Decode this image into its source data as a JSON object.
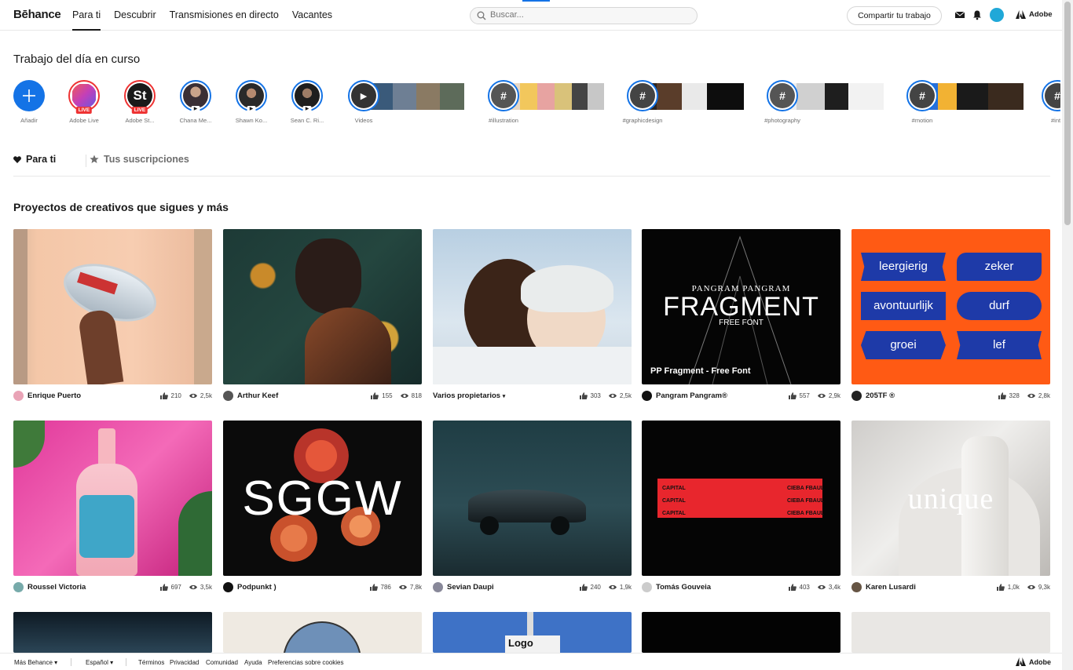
{
  "header": {
    "logo": "Bēhance",
    "nav": [
      "Para ti",
      "Descubrir",
      "Transmisiones en directo",
      "Vacantes"
    ],
    "search_placeholder": "Buscar...",
    "share_label": "Compartir tu trabajo",
    "adobe_label": "Adobe",
    "colors": {
      "accent": "#1473e6"
    }
  },
  "featured": {
    "title": "Trabajo del día en curso",
    "stories": [
      {
        "label": "Añadir"
      },
      {
        "label": "Adobe Live",
        "badge": "LIVE"
      },
      {
        "label": "Adobe St...",
        "badge": "LIVE",
        "glyph": "St"
      },
      {
        "label": "Chana Me..."
      },
      {
        "label": "Shawn Ko..."
      },
      {
        "label": "Sean C. Ri..."
      },
      {
        "label": "Videos"
      },
      {
        "label": "#illustration",
        "glyph": "#"
      },
      {
        "label": "#graphicdesign",
        "glyph": "#"
      },
      {
        "label": "#photography",
        "glyph": "#"
      },
      {
        "label": "#motion",
        "glyph": "#"
      },
      {
        "label": "#inte",
        "glyph": "#"
      }
    ]
  },
  "tabs": {
    "for_you": "Para ti",
    "subscriptions": "Tus suscripciones"
  },
  "projects": {
    "title": "Proyectos de creativos que sigues y más",
    "items": [
      {
        "owner": "Enrique Puerto",
        "likes": "210",
        "views": "2,5k"
      },
      {
        "owner": "Arthur Keef",
        "likes": "155",
        "views": "818"
      },
      {
        "owner": "Varios propietarios",
        "likes": "303",
        "views": "2,5k"
      },
      {
        "owner": "Pangram Pangram®",
        "likes": "557",
        "views": "2,9k",
        "caption": "PP Fragment - Free Font",
        "art_top": "PANGRAM PANGRAM",
        "art_main": "FRAGMENT",
        "art_sub": "FREE FONT"
      },
      {
        "owner": "205TF ®",
        "likes": "328",
        "views": "2,8k",
        "words": [
          "leergierig",
          "zeker",
          "avontuurlijk",
          "durf",
          "groei",
          "lef"
        ]
      },
      {
        "owner": "Roussel Victoria",
        "likes": "697",
        "views": "3,5k"
      },
      {
        "owner": "Podpunkt )",
        "likes": "786",
        "views": "7,8k",
        "art_main": "SGGW"
      },
      {
        "owner": "Sevian Daupi",
        "likes": "240",
        "views": "1,9k"
      },
      {
        "owner": "Tomás Gouveia",
        "likes": "403",
        "views": "3,4k",
        "art_left": "CAPITAL",
        "art_right": "CIEBA FBAUL"
      },
      {
        "owner": "Karen Lusardi",
        "likes": "1,0k",
        "views": "9,3k",
        "art_main": "unique"
      }
    ],
    "logo_text": "Logo"
  },
  "footer": {
    "more": "Más Behance",
    "language": "Español",
    "links": [
      "Términos",
      "Privacidad",
      "Comunidad",
      "Ayuda",
      "Preferencias sobre cookies"
    ],
    "adobe": "Adobe"
  }
}
